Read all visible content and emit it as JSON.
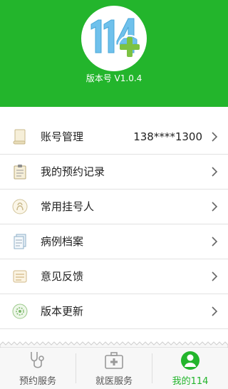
{
  "header": {
    "logo_text": "114",
    "version": "版本号 V1.0.4",
    "color": "#23b52c"
  },
  "menu": [
    {
      "icon": "scroll-icon",
      "label": "账号管理",
      "value": "138****1300"
    },
    {
      "icon": "clipboard-icon",
      "label": "我的预约记录",
      "value": ""
    },
    {
      "icon": "person-icon",
      "label": "常用挂号人",
      "value": ""
    },
    {
      "icon": "document-stack-icon",
      "label": "病例档案",
      "value": ""
    },
    {
      "icon": "feedback-icon",
      "label": "意见反馈",
      "value": ""
    },
    {
      "icon": "update-icon",
      "label": "版本更新",
      "value": ""
    }
  ],
  "tabs": [
    {
      "icon": "stethoscope-icon",
      "label": "预约服务",
      "active": false
    },
    {
      "icon": "medical-kit-icon",
      "label": "就医服务",
      "active": false
    },
    {
      "icon": "user-avatar-icon",
      "label": "我的114",
      "active": true
    }
  ]
}
